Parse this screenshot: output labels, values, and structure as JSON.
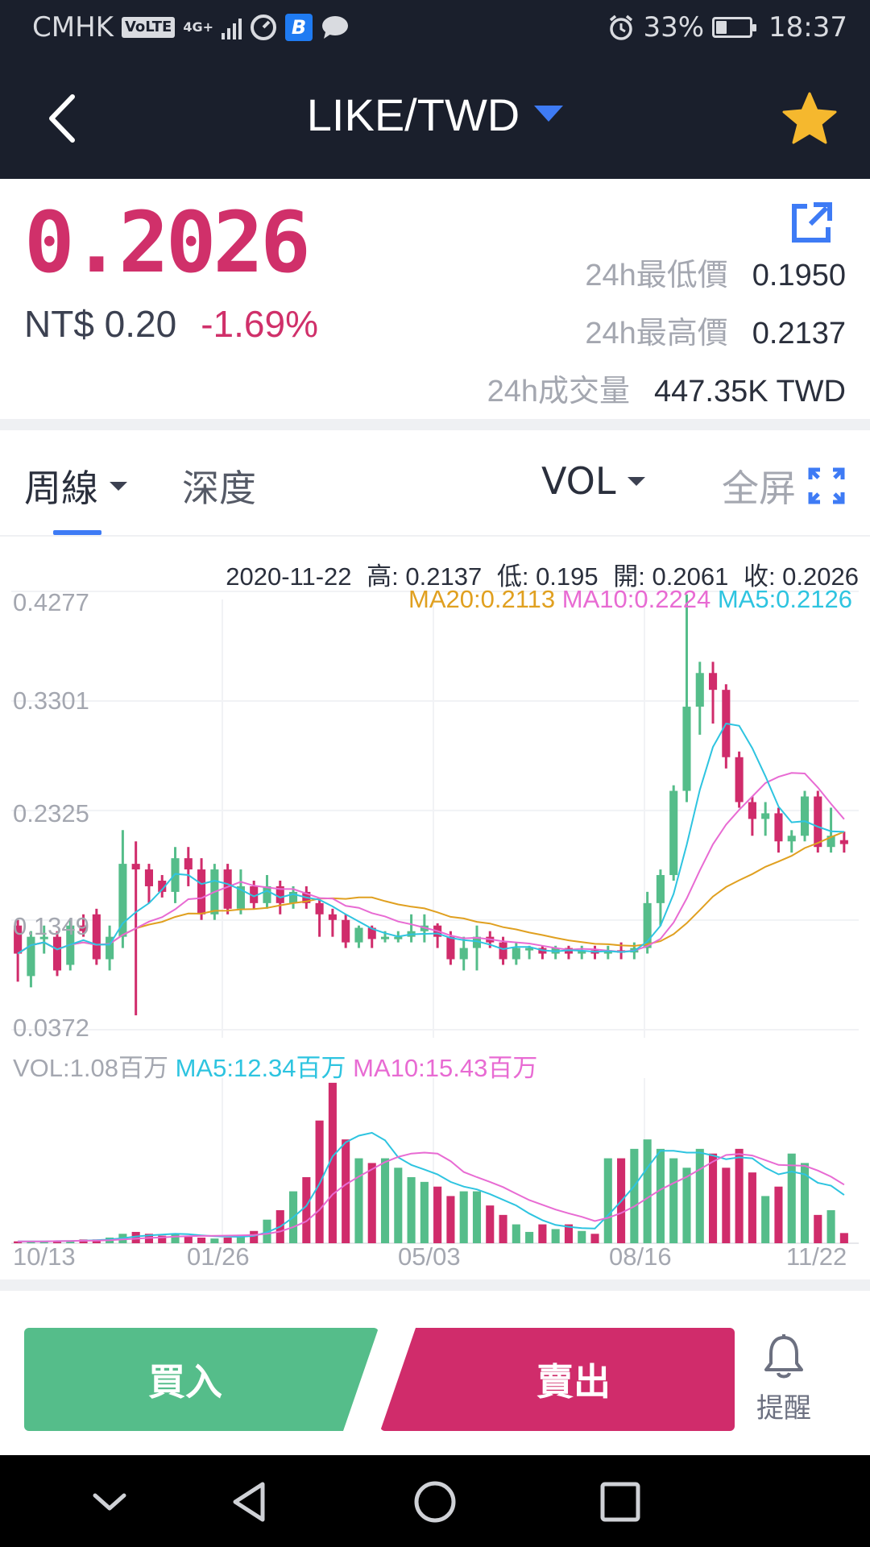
{
  "status_bar": {
    "carrier": "CMHK",
    "volte_badge": "VoLTE",
    "network": "4G+",
    "battery_percent": "33%",
    "battery_level": 0.33,
    "time": "18:37"
  },
  "nav": {
    "title": "LIKE/TWD"
  },
  "ticker": {
    "price": "0.2026",
    "fiat_price": "NT$ 0.20",
    "change": "-1.69%",
    "low_label": "24h最低價",
    "low_value": "0.1950",
    "high_label": "24h最高價",
    "high_value": "0.2137",
    "volume_label": "24h成交量",
    "volume_value": "447.35K TWD"
  },
  "tabs": {
    "weekly": "周線",
    "depth": "深度",
    "vol": "VOL",
    "fullscreen": "全屏"
  },
  "chart_info": {
    "date": "2020-11-22",
    "high": "高: 0.2137",
    "low": "低: 0.195",
    "open": "開: 0.2061",
    "close": "收: 0.2026",
    "ma20": "MA20:0.2113",
    "ma10": "MA10:0.2224",
    "ma5": "MA5:0.2126",
    "vol": "VOL:1.08百万",
    "vol_ma5": "MA5:12.34百万",
    "vol_ma10": "MA10:15.43百万"
  },
  "colors": {
    "up": "#55bd8a",
    "down": "#d02c6b",
    "ma5": "#2ec4e0",
    "ma10": "#e86bd3",
    "ma20": "#e0a020",
    "accent": "#3e7bf5"
  },
  "chart_data": {
    "type": "candlestick",
    "y_ticks": [
      "0.4277",
      "0.3301",
      "0.2325",
      "0.1349",
      "0.0372"
    ],
    "ylim": [
      0.0372,
      0.4277
    ],
    "x_ticks": [
      "10/13",
      "01/26",
      "05/03",
      "08/16",
      "11/22"
    ],
    "candles": [
      [
        0.13,
        0.105,
        0.08,
        0.135
      ],
      [
        0.085,
        0.12,
        0.075,
        0.125
      ],
      [
        0.12,
        0.12,
        0.105,
        0.13
      ],
      [
        0.12,
        0.09,
        0.085,
        0.125
      ],
      [
        0.095,
        0.13,
        0.09,
        0.135
      ],
      [
        0.13,
        0.125,
        0.12,
        0.14
      ],
      [
        0.14,
        0.1,
        0.095,
        0.145
      ],
      [
        0.1,
        0.12,
        0.09,
        0.13
      ],
      [
        0.12,
        0.185,
        0.11,
        0.215
      ],
      [
        0.185,
        0.18,
        0.05,
        0.205
      ],
      [
        0.18,
        0.165,
        0.15,
        0.185
      ],
      [
        0.17,
        0.16,
        0.155,
        0.175
      ],
      [
        0.16,
        0.19,
        0.15,
        0.2
      ],
      [
        0.19,
        0.18,
        0.165,
        0.2
      ],
      [
        0.18,
        0.14,
        0.135,
        0.19
      ],
      [
        0.14,
        0.18,
        0.135,
        0.185
      ],
      [
        0.18,
        0.145,
        0.14,
        0.185
      ],
      [
        0.145,
        0.165,
        0.14,
        0.18
      ],
      [
        0.165,
        0.15,
        0.145,
        0.17
      ],
      [
        0.15,
        0.165,
        0.145,
        0.175
      ],
      [
        0.165,
        0.15,
        0.14,
        0.17
      ],
      [
        0.15,
        0.16,
        0.145,
        0.165
      ],
      [
        0.16,
        0.15,
        0.145,
        0.165
      ],
      [
        0.15,
        0.14,
        0.12,
        0.155
      ],
      [
        0.14,
        0.135,
        0.12,
        0.145
      ],
      [
        0.135,
        0.115,
        0.11,
        0.14
      ],
      [
        0.115,
        0.128,
        0.11,
        0.13
      ],
      [
        0.128,
        0.118,
        0.11,
        0.13
      ],
      [
        0.118,
        0.12,
        0.115,
        0.125
      ],
      [
        0.12,
        0.12,
        0.115,
        0.125
      ],
      [
        0.12,
        0.125,
        0.115,
        0.14
      ],
      [
        0.125,
        0.13,
        0.115,
        0.14
      ],
      [
        0.13,
        0.12,
        0.11,
        0.132
      ],
      [
        0.12,
        0.1,
        0.095,
        0.125
      ],
      [
        0.1,
        0.11,
        0.09,
        0.12
      ],
      [
        0.11,
        0.12,
        0.09,
        0.13
      ],
      [
        0.12,
        0.115,
        0.11,
        0.125
      ],
      [
        0.115,
        0.1,
        0.095,
        0.12
      ],
      [
        0.1,
        0.11,
        0.095,
        0.115
      ],
      [
        0.11,
        0.11,
        0.1,
        0.112
      ],
      [
        0.11,
        0.105,
        0.1,
        0.112
      ],
      [
        0.105,
        0.11,
        0.1,
        0.112
      ],
      [
        0.11,
        0.105,
        0.1,
        0.112
      ],
      [
        0.105,
        0.108,
        0.1,
        0.112
      ],
      [
        0.108,
        0.105,
        0.1,
        0.112
      ],
      [
        0.105,
        0.108,
        0.1,
        0.112
      ],
      [
        0.108,
        0.106,
        0.1,
        0.115
      ],
      [
        0.106,
        0.11,
        0.1,
        0.115
      ],
      [
        0.11,
        0.15,
        0.105,
        0.16
      ],
      [
        0.15,
        0.175,
        0.13,
        0.18
      ],
      [
        0.175,
        0.25,
        0.17,
        0.255
      ],
      [
        0.25,
        0.325,
        0.24,
        0.425
      ],
      [
        0.325,
        0.355,
        0.3,
        0.365
      ],
      [
        0.355,
        0.34,
        0.31,
        0.365
      ],
      [
        0.34,
        0.28,
        0.27,
        0.345
      ],
      [
        0.28,
        0.24,
        0.235,
        0.285
      ],
      [
        0.24,
        0.225,
        0.21,
        0.245
      ],
      [
        0.225,
        0.23,
        0.21,
        0.24
      ],
      [
        0.23,
        0.205,
        0.195,
        0.235
      ],
      [
        0.205,
        0.21,
        0.195,
        0.215
      ],
      [
        0.21,
        0.245,
        0.205,
        0.25
      ],
      [
        0.245,
        0.2,
        0.195,
        0.25
      ],
      [
        0.2,
        0.21,
        0.195,
        0.235
      ],
      [
        0.2061,
        0.2026,
        0.195,
        0.2137
      ]
    ],
    "volumes": [
      0.2,
      0.2,
      0.2,
      0.3,
      0.3,
      0.4,
      0.4,
      0.6,
      1.0,
      1.2,
      1.0,
      0.8,
      1.0,
      0.8,
      0.6,
      0.5,
      0.6,
      0.9,
      1.3,
      2.5,
      3.5,
      5.5,
      7.0,
      13.0,
      17.0,
      11.0,
      9.0,
      8.5,
      9.0,
      8.0,
      7.0,
      6.5,
      6.0,
      5.0,
      5.5,
      5.5,
      4.0,
      3.0,
      2.0,
      1.2,
      2.0,
      1.5,
      2.0,
      1.3,
      1.0,
      9.0,
      9.0,
      10.0,
      11.0,
      10.0,
      9.0,
      8.0,
      10.0,
      9.5,
      8.0,
      10.0,
      7.5,
      5.0,
      6.0,
      9.5,
      8.5,
      3.0,
      3.5,
      1.08
    ],
    "vol_ylim": [
      0,
      17.5
    ]
  }
}
